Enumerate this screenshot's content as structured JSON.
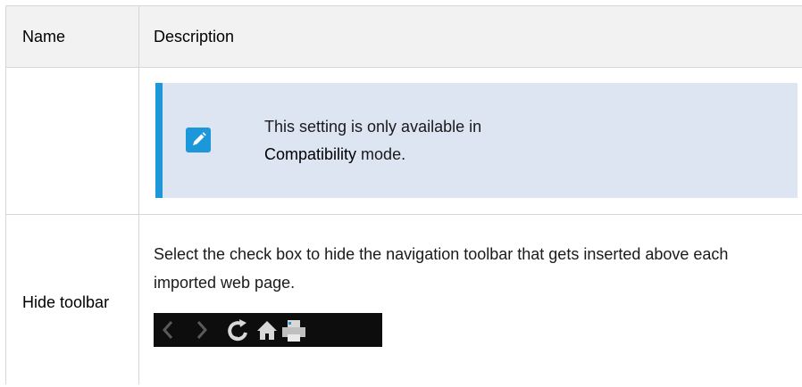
{
  "table": {
    "columns": [
      "Name",
      "Description"
    ],
    "note": {
      "icon": "pencil-note-icon",
      "line1": "This setting is only available in",
      "emphasis": "Compatibility",
      "suffix": " mode."
    },
    "rows": [
      {
        "name": "Hide toolbar",
        "description": "Select the check box to hide the navigation toolbar that gets inserted above each imported web page.",
        "image_icons": [
          "back-arrow-icon",
          "forward-arrow-icon",
          "refresh-icon",
          "home-icon",
          "print-icon"
        ]
      }
    ]
  },
  "colors": {
    "note_accent": "#1b97da",
    "note_background": "#dde5f3",
    "header_background": "#f2f2f2"
  }
}
